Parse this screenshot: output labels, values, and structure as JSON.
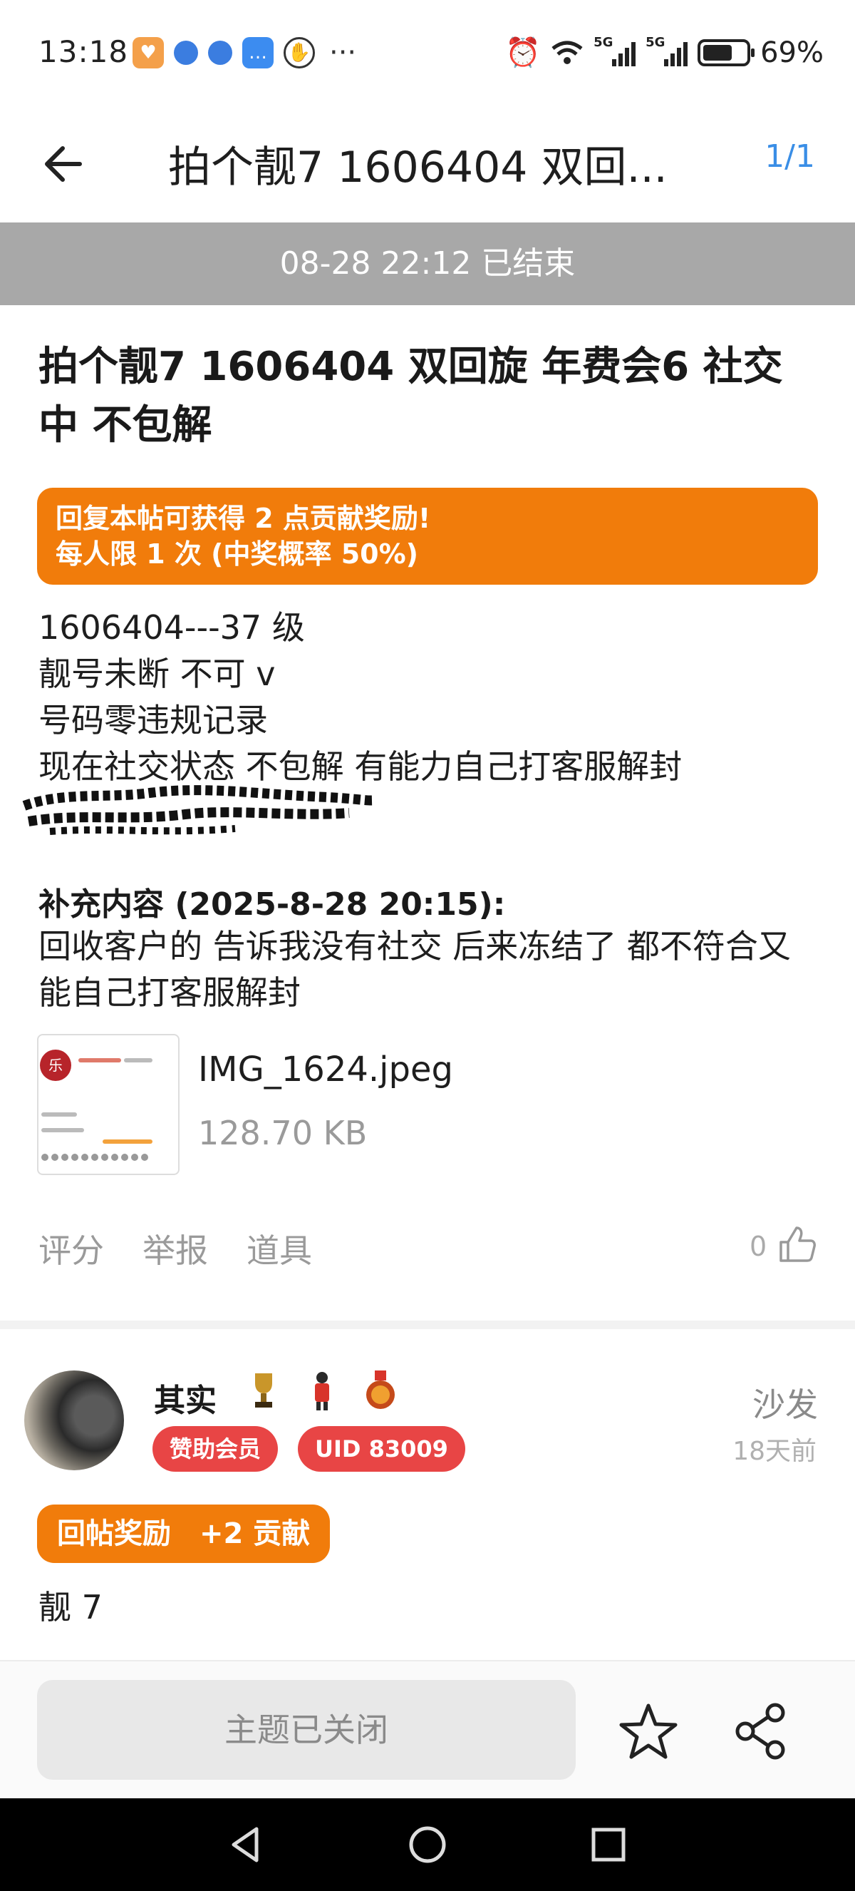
{
  "status_bar": {
    "time": "13:18",
    "battery_percent": "69%",
    "signal_tag_1": "5G",
    "signal_tag_2": "5G",
    "more": "···",
    "battery_level": 0.69
  },
  "header": {
    "title": "拍个靓7 1606404 双回...",
    "page_indicator": "1/1"
  },
  "status_banner": "08-28 22:12 已结束",
  "post": {
    "title": "拍个靓7 1606404 双回旋 年费会6 社交中 不包解",
    "reward_line_1": "回复本帖可获得 2 点贡献奖励!",
    "reward_line_2": "每人限 1 次 (中奖概率 50%)",
    "lines": [
      "1606404---37 级",
      "靓号未断 不可 v",
      "号码零违规记录",
      "现在社交状态 不包解 有能力自己打客服解封"
    ],
    "supplement_title": "补充内容 (2025-8-28 20:15):",
    "supplement_text": "回收客户的 告诉我没有社交 后来冻结了 都不符合又能自己打客服解封",
    "attachment": {
      "name": "IMG_1624.jpeg",
      "size": "128.70 KB"
    },
    "actions": [
      "评分",
      "举报",
      "道具"
    ],
    "like_count": "0"
  },
  "reply": {
    "username": "其实",
    "badges": [
      "赞助会员",
      "UID 83009"
    ],
    "floor": "沙发",
    "time_ago": "18天前",
    "reward": "回帖奖励　+2 贡献",
    "text": "靓 7"
  },
  "bottom_bar": {
    "closed_label": "主题已关闭"
  },
  "colors": {
    "accent_orange": "#f17c0b",
    "badge_red": "#e84545",
    "link_blue": "#3a8ee6",
    "banner_gray": "#a8a8a8"
  },
  "icons": {
    "back": "arrow-left-icon",
    "like": "thumbs-up-icon",
    "star": "star-icon",
    "share": "share-icon",
    "nav_back": "triangle-back-icon",
    "nav_home": "circle-home-icon",
    "nav_recents": "square-recents-icon"
  }
}
